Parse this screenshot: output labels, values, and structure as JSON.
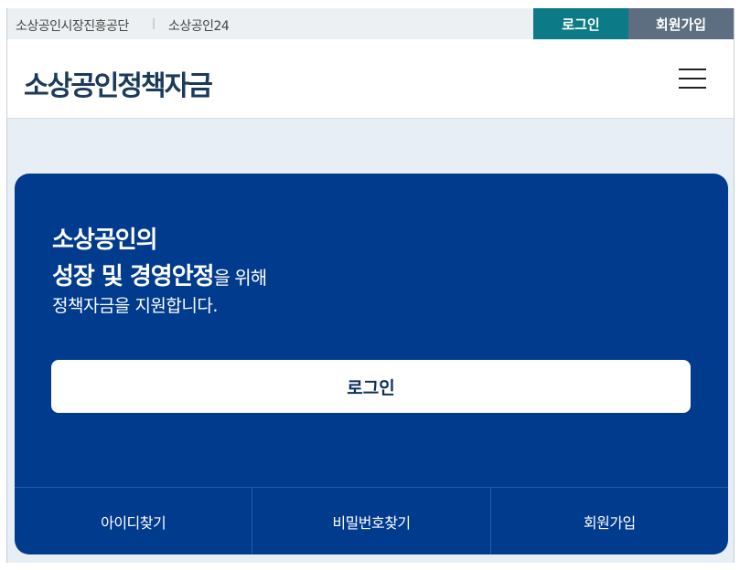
{
  "utility_bar": {
    "links": [
      "소상공인시장진흥공단",
      "소상공인24"
    ],
    "separator": "|",
    "login_label": "로그인",
    "join_label": "회원가입"
  },
  "header": {
    "logo": "소상공인정책자금",
    "menu_icon": "hamburger-menu-icon"
  },
  "hero": {
    "line1": "소상공인의",
    "line2_bold": "성장 및 경영안정",
    "line2_suffix": "을 위해",
    "line3": "정책자금을 지원합니다."
  },
  "login_button": "로그인",
  "bottom_links": [
    "아이디찾기",
    "비밀번호찾기",
    "회원가입"
  ],
  "colors": {
    "primary": "#003b8e",
    "teal": "#0d7b87",
    "slate": "#5c6e80",
    "page_bg": "#e8eef5"
  }
}
